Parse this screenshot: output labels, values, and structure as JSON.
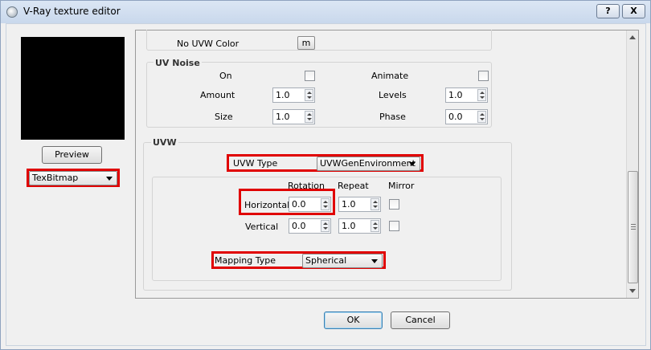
{
  "window": {
    "title": "V-Ray texture editor",
    "help_label": "?",
    "close_label": "X",
    "icon": "vray-app-icon"
  },
  "left": {
    "preview_button": "Preview",
    "texture_type": "TexBitmap"
  },
  "top_params": {
    "no_uvw_color_label": "No UVW Color",
    "no_uvw_color_button": "m"
  },
  "uv_noise": {
    "title": "UV Noise",
    "on_label": "On",
    "on_checked": false,
    "animate_label": "Animate",
    "animate_checked": false,
    "amount_label": "Amount",
    "amount_value": "1.0",
    "levels_label": "Levels",
    "levels_value": "1.0",
    "size_label": "Size",
    "size_value": "1.0",
    "phase_label": "Phase",
    "phase_value": "0.0"
  },
  "uvw": {
    "title": "UVW",
    "uvw_type_label": "UVW Type",
    "uvw_type_value": "UVWGenEnvironment",
    "col_rotation": "Rotation",
    "col_repeat": "Repeat",
    "col_mirror": "Mirror",
    "horizontal_label": "Horizontal",
    "horizontal_rotation": "0.0",
    "horizontal_repeat": "1.0",
    "horizontal_mirror": false,
    "vertical_label": "Vertical",
    "vertical_rotation": "0.0",
    "vertical_repeat": "1.0",
    "vertical_mirror": false,
    "mapping_type_label": "Mapping Type",
    "mapping_type_value": "Spherical"
  },
  "footer": {
    "ok_label": "OK",
    "cancel_label": "Cancel"
  },
  "highlight_color": "#e00000"
}
